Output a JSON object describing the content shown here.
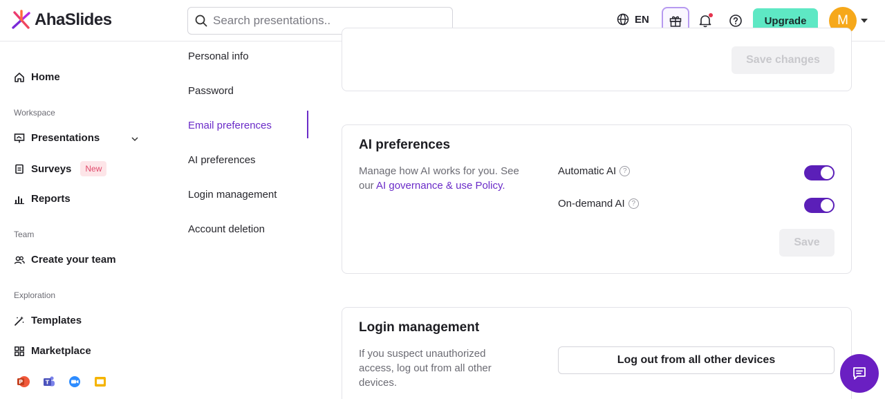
{
  "header": {
    "logo_text": "AhaSlides",
    "search_placeholder": "Search presentations..",
    "language": "EN",
    "upgrade_label": "Upgrade",
    "avatar_initial": "M"
  },
  "sidebar": {
    "home": "Home",
    "sections": {
      "workspace": "Workspace",
      "team": "Team",
      "exploration": "Exploration"
    },
    "items": {
      "presentations": "Presentations",
      "surveys": "Surveys",
      "surveys_badge": "New",
      "reports": "Reports",
      "create_team": "Create your team",
      "templates": "Templates",
      "marketplace": "Marketplace"
    },
    "integrations": [
      "powerpoint-icon",
      "teams-icon",
      "zoom-icon",
      "google-slides-icon"
    ]
  },
  "settings_menu": {
    "items": [
      "Personal info",
      "Password",
      "Email preferences",
      "AI preferences",
      "Login management",
      "Account deletion"
    ],
    "active": "Email preferences"
  },
  "email_card": {
    "save_label": "Save changes"
  },
  "ai_card": {
    "title": "AI preferences",
    "desc_prefix": "Manage how AI works for you. See our ",
    "desc_link": "AI governance & use Policy.",
    "automatic_label": "Automatic AI",
    "automatic_on": true,
    "ondemand_label": "On-demand AI",
    "ondemand_on": true,
    "save_label": "Save"
  },
  "login_card": {
    "title": "Login management",
    "desc": "If you suspect unauthorized access, log out from all other devices.",
    "logout_label": "Log out from all other devices"
  },
  "colors": {
    "accent": "#6a2bc8",
    "upgrade": "#5ee8c4",
    "avatar": "#f6a81a"
  }
}
